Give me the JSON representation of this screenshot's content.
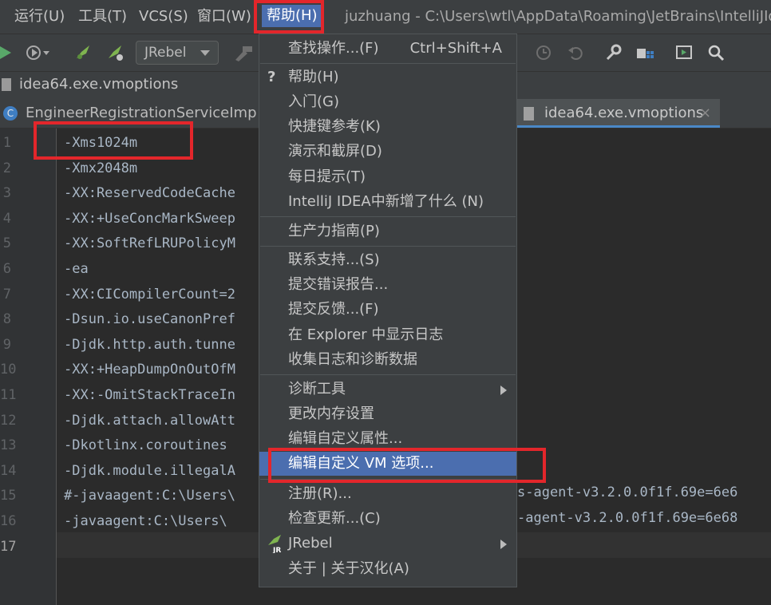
{
  "menubar": {
    "items": [
      "运行(U)",
      "工具(T)",
      "VCS(S)",
      "窗口(W)"
    ],
    "active": "帮助(H)",
    "window_title": "juzhuang - C:\\Users\\wtl\\AppData\\Roaming\\JetBrains\\IntelliJId"
  },
  "toolbar": {
    "jrebel_combo": "JRebel"
  },
  "navbar": {
    "file": "idea64.exe.vmoptions"
  },
  "tabs": {
    "tab1": "EngineerRegistrationServiceImpl.ja",
    "tab1_icon": "C",
    "tab2": "idea64.exe.vmoptions",
    "tab2_close": "×"
  },
  "editor": {
    "line_numbers": [
      "1",
      "2",
      "3",
      "4",
      "5",
      "6",
      "7",
      "8",
      "9",
      "10",
      "11",
      "12",
      "13",
      "14",
      "15",
      "16",
      "17"
    ],
    "lines_left": [
      "-Xms1024m",
      "-Xmx2048m",
      "-XX:ReservedCodeCache",
      "-XX:+UseConcMarkSweep",
      "-XX:SoftRefLRUPolicyM",
      "-ea",
      "-XX:CICompilerCount=2",
      "-Dsun.io.useCanonPref",
      "-Djdk.http.auth.tunne",
      "-XX:+HeapDumpOnOutOfM",
      "-XX:-OmitStackTraceIn",
      "-Djdk.attach.allowAtt",
      "-Dkotlinx.coroutines",
      "-Djdk.module.illegalA",
      "#-javaagent:C:\\Users\\",
      "-javaagent:C:\\Users\\",
      ""
    ],
    "line15_right": "s-agent-v3.2.0.0f1f.69e=6e6",
    "line16_right": "-agent-v3.2.0.0f1f.69e=6e68"
  },
  "help_menu": {
    "find_action": "查找操作...(F)",
    "find_action_shortcut": "Ctrl+Shift+A",
    "help": "帮助(H)",
    "help_icon": "?",
    "getting_started": "入门(G)",
    "keymap_ref": "快捷键参考(K)",
    "demos": "演示和截屏(D)",
    "tip_of_day": "每日提示(T)",
    "whats_new": "IntelliJ IDEA中新增了什么 (N)",
    "productivity": "生产力指南(P)",
    "contact_support": "联系支持...(S)",
    "submit_bug": "提交错误报告...",
    "submit_feedback": "提交反馈...(F)",
    "show_log": "在 Explorer 中显示日志",
    "collect_logs": "收集日志和诊断数据",
    "diagnostic_tools": "诊断工具",
    "change_memory": "更改内存设置",
    "edit_properties": "编辑自定义属性...",
    "edit_vm_options": "编辑自定义 VM 选项...",
    "register": "注册(R)...",
    "check_updates": "检查更新...(C)",
    "jrebel": "JRebel",
    "jrebel_icon_text": "JR",
    "about": "关于 | 关于汉化(A)"
  },
  "colors": {
    "accent_selection": "#4b6eaf",
    "highlight_box": "#e3262b"
  }
}
